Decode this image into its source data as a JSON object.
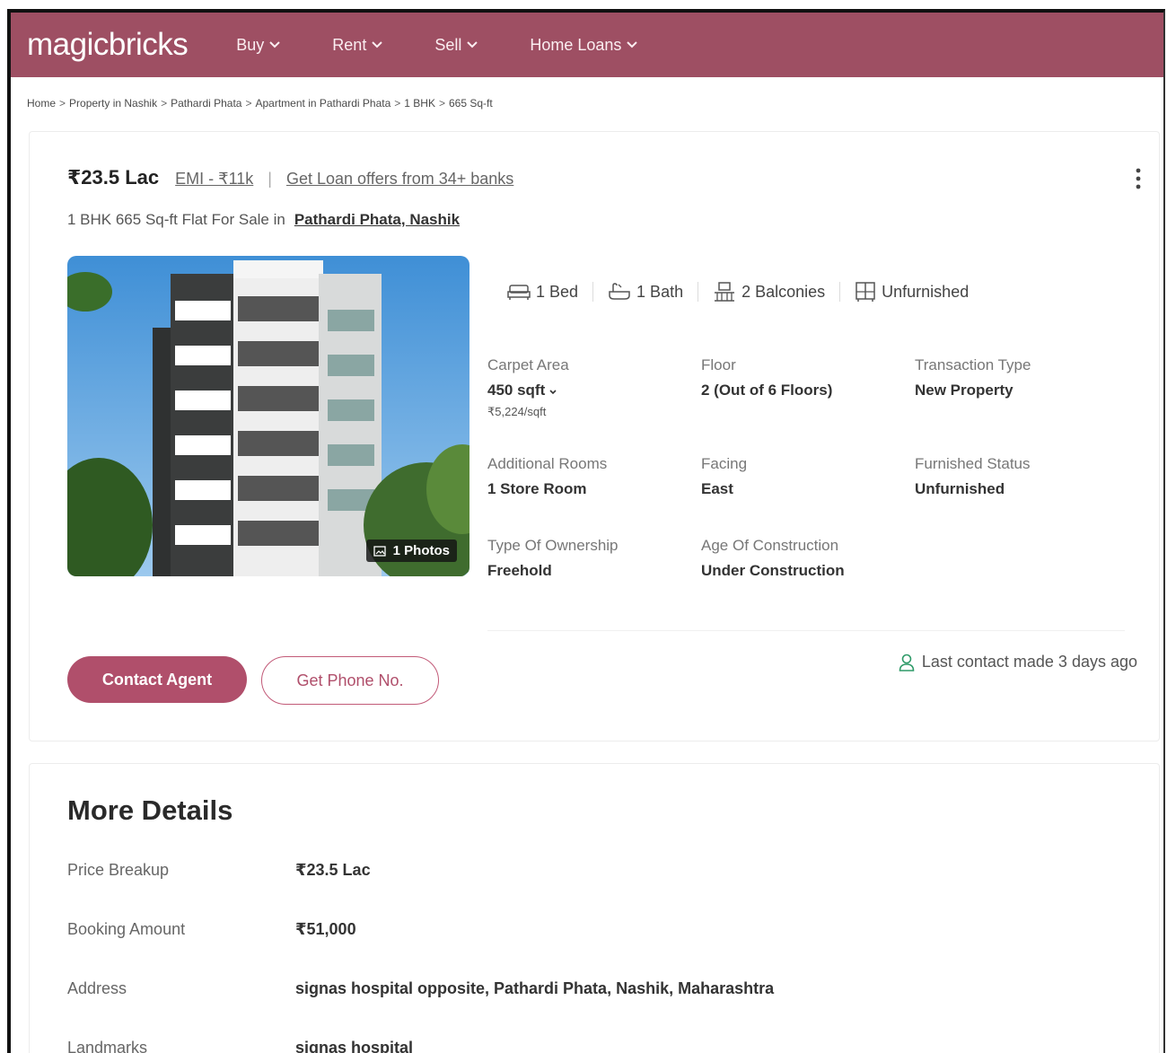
{
  "header": {
    "logo": "magicbricks",
    "nav": [
      {
        "label": "Buy"
      },
      {
        "label": "Rent"
      },
      {
        "label": "Sell"
      },
      {
        "label": "Home Loans"
      }
    ]
  },
  "breadcrumb": [
    "Home",
    "Property in Nashik",
    "Pathardi Phata",
    "Apartment in Pathardi Phata",
    "1 BHK",
    "665 Sq-ft"
  ],
  "listing": {
    "price": "₹23.5 Lac",
    "emi": "EMI - ₹11k",
    "loan_offer": "Get Loan offers from 34+ banks",
    "subtitle": "1 BHK 665 Sq-ft Flat For Sale in",
    "location": "Pathardi Phata, Nashik",
    "photo_badge": "1 Photos",
    "amenities": {
      "bed": "1 Bed",
      "bath": "1 Bath",
      "balconies": "2 Balconies",
      "furnished": "Unfurnished"
    },
    "specs": {
      "carpet_label": "Carpet Area",
      "carpet_value": "450 sqft",
      "carpet_rate": "₹5,224/sqft",
      "floor_label": "Floor",
      "floor_value": "2 (Out of 6 Floors)",
      "transaction_label": "Transaction Type",
      "transaction_value": "New Property",
      "rooms_label": "Additional Rooms",
      "rooms_value": "1 Store Room",
      "facing_label": "Facing",
      "facing_value": "East",
      "furnished_label": "Furnished Status",
      "furnished_value": "Unfurnished",
      "ownership_label": "Type Of Ownership",
      "ownership_value": "Freehold",
      "age_label": "Age Of Construction",
      "age_value": "Under Construction"
    },
    "contact_button": "Contact Agent",
    "phone_button": "Get Phone No.",
    "last_contact": "Last contact made 3 days ago"
  },
  "more_details": {
    "title": "More Details",
    "rows": [
      {
        "label": "Price Breakup",
        "value": "₹23.5 Lac"
      },
      {
        "label": "Booking Amount",
        "value": "₹51,000"
      },
      {
        "label": "Address",
        "value": "signas hospital opposite, Pathardi Phata, Nashik, Maharashtra"
      },
      {
        "label": "Landmarks",
        "value": "signas hospital"
      }
    ]
  },
  "colors": {
    "brand": "#9e4f63",
    "accent": "#b04f6b",
    "contact_icon": "#2e9a68"
  },
  "icons": [
    "chevron-down-icon",
    "kebab-menu-icon",
    "bed-icon",
    "bath-icon",
    "balcony-icon",
    "furniture-icon",
    "photo-icon",
    "user-icon"
  ]
}
